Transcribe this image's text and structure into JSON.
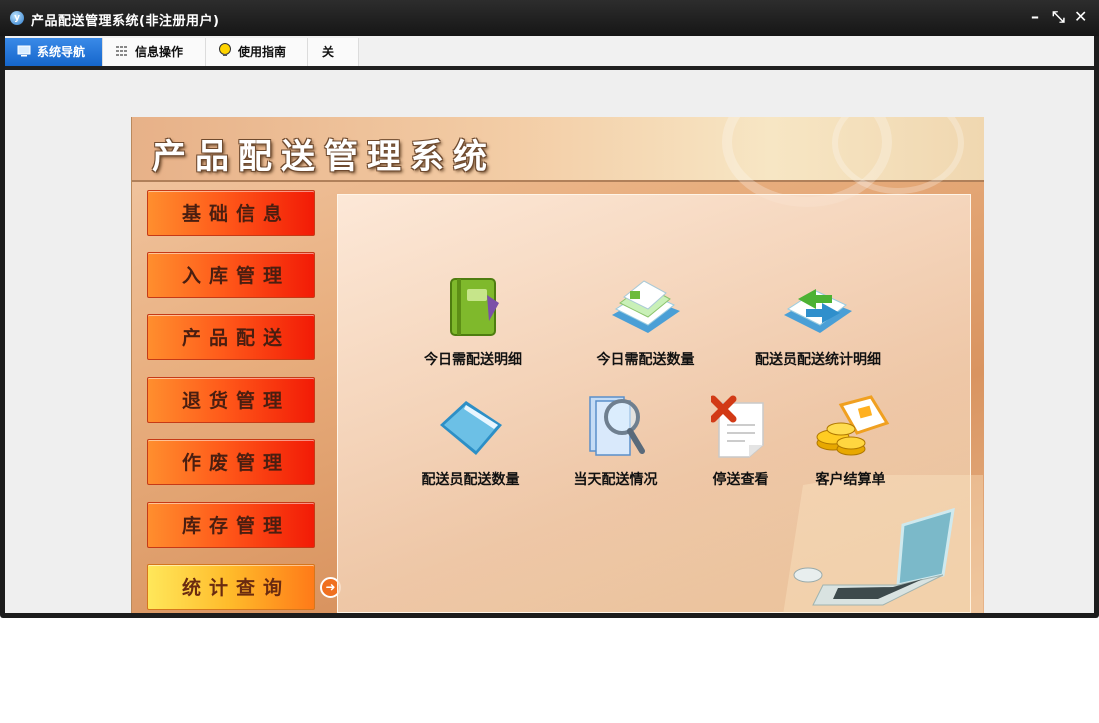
{
  "window": {
    "title": "产品配送管理系统(非注册用户)",
    "minimize_glyph": "–",
    "restore_glyph": "⤡",
    "close_glyph": "✕"
  },
  "menu": {
    "tabs": [
      {
        "label": "系统导航",
        "icon": "monitor-icon",
        "active": true
      },
      {
        "label": "信息操作",
        "icon": "grid-icon",
        "active": false
      },
      {
        "label": "使用指南",
        "icon": "lightbulb-icon",
        "active": false
      },
      {
        "label": "关于",
        "icon": "",
        "active": false
      }
    ]
  },
  "panel": {
    "title": "产品配送管理系统",
    "nav": [
      {
        "label": "基础信息"
      },
      {
        "label": "入库管理"
      },
      {
        "label": "产品配送"
      },
      {
        "label": "退货管理"
      },
      {
        "label": "作废管理"
      },
      {
        "label": "库存管理"
      },
      {
        "label": "统计查询",
        "active": true
      }
    ],
    "functions": [
      {
        "label": "今日需配送明细",
        "icon": "green-book-icon"
      },
      {
        "label": "今日需配送数量",
        "icon": "stacked-documents-icon"
      },
      {
        "label": "配送员配送统计明细",
        "icon": "transfer-arrows-icon"
      },
      {
        "label": "配送员配送数量",
        "icon": "blue-folder-icon"
      },
      {
        "label": "当天配送情况",
        "icon": "magnifier-icon"
      },
      {
        "label": "停送查看",
        "icon": "cancel-document-icon"
      },
      {
        "label": "客户结算单",
        "icon": "coins-document-icon"
      }
    ]
  },
  "colors": {
    "active_tab": "#1566cc",
    "nav_button": "#f21b06",
    "nav_button_active": "#ffba2a"
  }
}
